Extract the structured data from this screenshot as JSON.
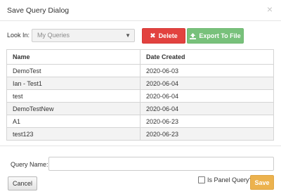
{
  "dialog": {
    "title": "Save Query Dialog",
    "close_glyph": "×"
  },
  "lookin": {
    "label": "Look In:",
    "selected": "My Queries"
  },
  "buttons": {
    "delete_label": "Delete",
    "export_label": "Export To File",
    "cancel_label": "Cancel",
    "save_label": "Save"
  },
  "table": {
    "headers": [
      "Name",
      "Date Created"
    ],
    "rows": [
      [
        "DemoTest",
        "2020-06-03"
      ],
      [
        "Ian - Test1",
        "2020-06-04"
      ],
      [
        "test",
        "2020-06-04"
      ],
      [
        "DemoTestNew",
        "2020-06-04"
      ],
      [
        "A1",
        "2020-06-23"
      ],
      [
        "test123",
        "2020-06-23"
      ]
    ]
  },
  "query_name": {
    "label": "Query Name:",
    "value": ""
  },
  "panel_query": {
    "label": "Is Panel Query?",
    "checked": false
  },
  "icons": {
    "delete": "x-icon",
    "export": "upload-icon",
    "close": "close-icon",
    "select": "chevron-down-icon"
  },
  "colors": {
    "delete": "#e2423f",
    "export": "#78c17b",
    "save": "#ecb24e"
  }
}
